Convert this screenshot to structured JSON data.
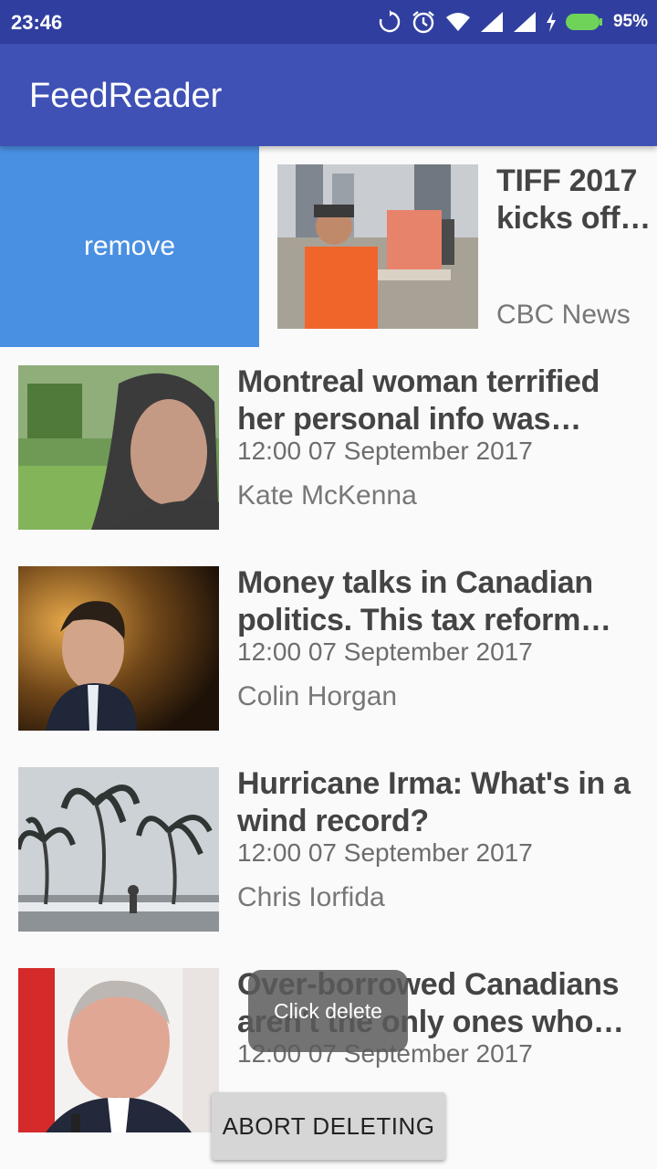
{
  "status_bar": {
    "time": "23:46",
    "battery_percent": "95%",
    "icons": [
      "sync-icon",
      "alarm-icon",
      "wifi-icon",
      "signal-icon",
      "signal-icon",
      "charging-icon",
      "battery-icon"
    ]
  },
  "app_bar": {
    "title": "FeedReader"
  },
  "swipe": {
    "remove_label": "remove"
  },
  "feed": {
    "items": [
      {
        "title": "TIFF 2017 kicks off …",
        "date": "",
        "author": "CBC News"
      },
      {
        "title": "Montreal woman terrified her personal info was posted…",
        "date": "12:00 07 September 2017",
        "author": "Kate McKenna"
      },
      {
        "title": "Money talks in Canadian politics. This tax reform should…",
        "date": "12:00 07 September 2017",
        "author": "Colin Horgan"
      },
      {
        "title": "Hurricane Irma: What's in a wind record?",
        "date": "12:00 07 September 2017",
        "author": "Chris Iorfida"
      },
      {
        "title": "Over-borrowed Canadians aren't the only ones who will …",
        "date": "12:00 07 September 2017",
        "author": ""
      }
    ]
  },
  "toast": {
    "text": "Click delete"
  },
  "snackbar": {
    "abort_label": "ABORT DELETING"
  },
  "colors": {
    "status_bar": "#303f9f",
    "app_bar": "#3f51b5",
    "remove_bg": "#4a90e2"
  }
}
